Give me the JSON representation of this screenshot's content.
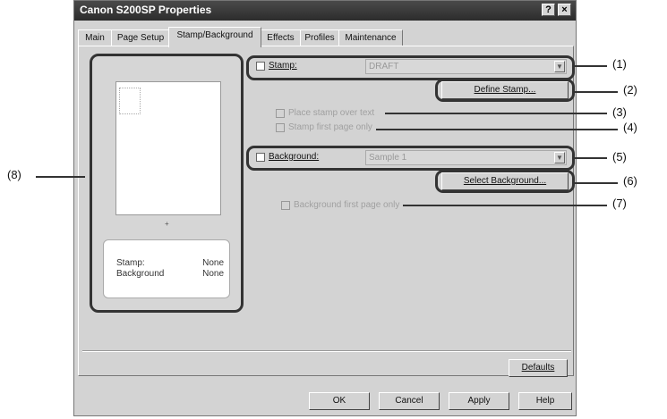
{
  "window": {
    "title": "Canon S200SP Properties",
    "help_glyph": "?",
    "close_glyph": "×"
  },
  "tabs": [
    {
      "label": "Main"
    },
    {
      "label": "Page Setup"
    },
    {
      "label": "Stamp/Background"
    },
    {
      "label": "Effects"
    },
    {
      "label": "Profiles"
    },
    {
      "label": "Maintenance"
    }
  ],
  "preview": {
    "marker": "+",
    "stamp_label": "Stamp:",
    "stamp_value": "None",
    "background_label": "Background",
    "background_value": "None"
  },
  "stamp": {
    "checkbox_label": "Stamp:",
    "value": "DRAFT",
    "define_button": "Define Stamp...",
    "opt1": "Place stamp over text",
    "opt2": "Stamp first page only"
  },
  "background": {
    "checkbox_label": "Background:",
    "value": "Sample 1",
    "select_button": "Select Background...",
    "opt1": "Background first page only"
  },
  "buttons": {
    "defaults": "Defaults",
    "ok": "OK",
    "cancel": "Cancel",
    "apply": "Apply",
    "help": "Help"
  },
  "callouts": {
    "c1": "(1)",
    "c2": "(2)",
    "c3": "(3)",
    "c4": "(4)",
    "c5": "(5)",
    "c6": "(6)",
    "c7": "(7)",
    "c8": "(8)"
  }
}
